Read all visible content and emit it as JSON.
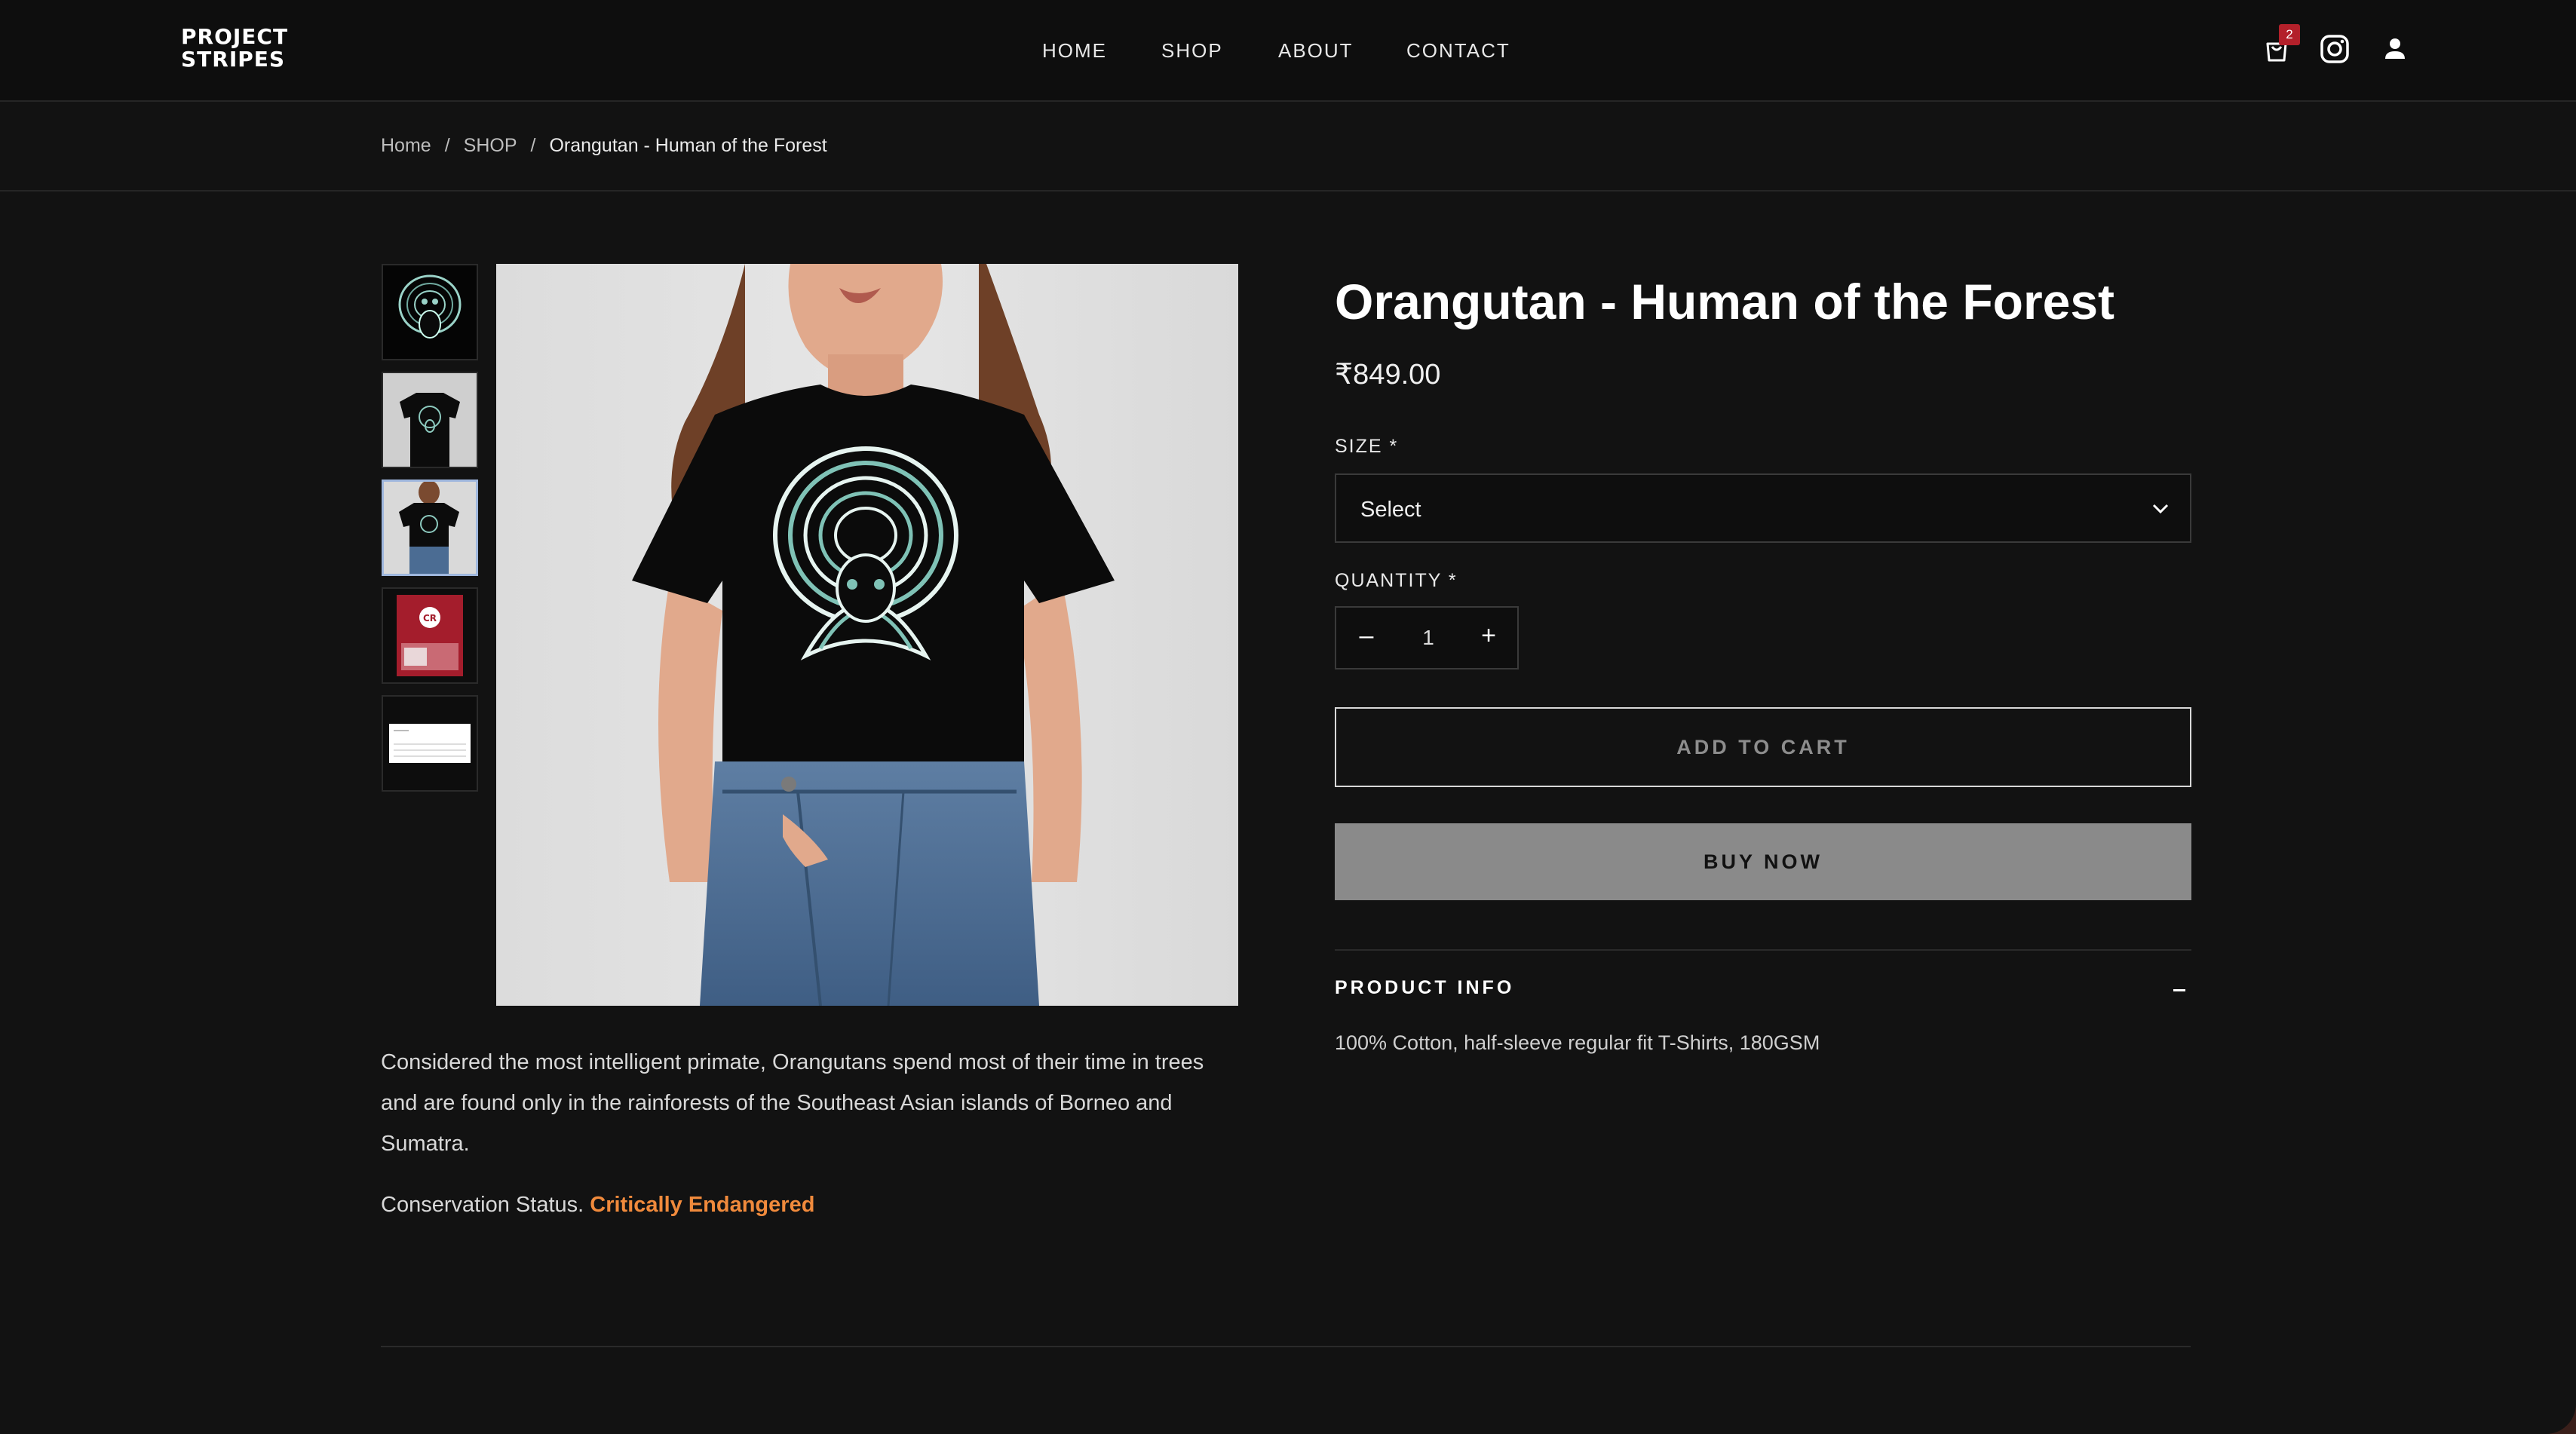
{
  "brand": {
    "logo_line1": "PROJECT",
    "logo_line2": "STRIPES"
  },
  "nav": [
    "HOME",
    "SHOP",
    "ABOUT",
    "CONTACT"
  ],
  "header_icons": {
    "cart": "cart-icon",
    "cart_count": "2",
    "instagram": "instagram-icon",
    "account": "user-icon"
  },
  "breadcrumb": {
    "home": "Home",
    "sep": "/",
    "shop": "SHOP",
    "current": "Orangutan - Human of the Forest"
  },
  "gallery": {
    "thumb_count": 5,
    "active_index": 2
  },
  "description": {
    "text": "Considered the most intelligent primate, Orangutans spend most of their time in trees and are found only in the rainforests of the Southeast Asian islands of Borneo and Sumatra.",
    "status_label": "Conservation Status.",
    "status_value": "Critically Endangered"
  },
  "product": {
    "title": "Orangutan - Human of the Forest",
    "price": "₹849.00",
    "size_label": "SIZE *",
    "size_value": "Select",
    "quantity_label": "QUANTITY *",
    "quantity_minus": "–",
    "quantity_value": "1",
    "quantity_plus": "+",
    "add_to_cart": "ADD TO CART",
    "buy_now": "BUY NOW",
    "info_title": "PRODUCT INFO",
    "info_text": "100% Cotton, half-sleeve regular fit T-Shirts, 180GSM"
  },
  "colors": {
    "accent_orange": "#f08a3c",
    "badge_red": "#b3202a",
    "page_bg": "#121212"
  }
}
